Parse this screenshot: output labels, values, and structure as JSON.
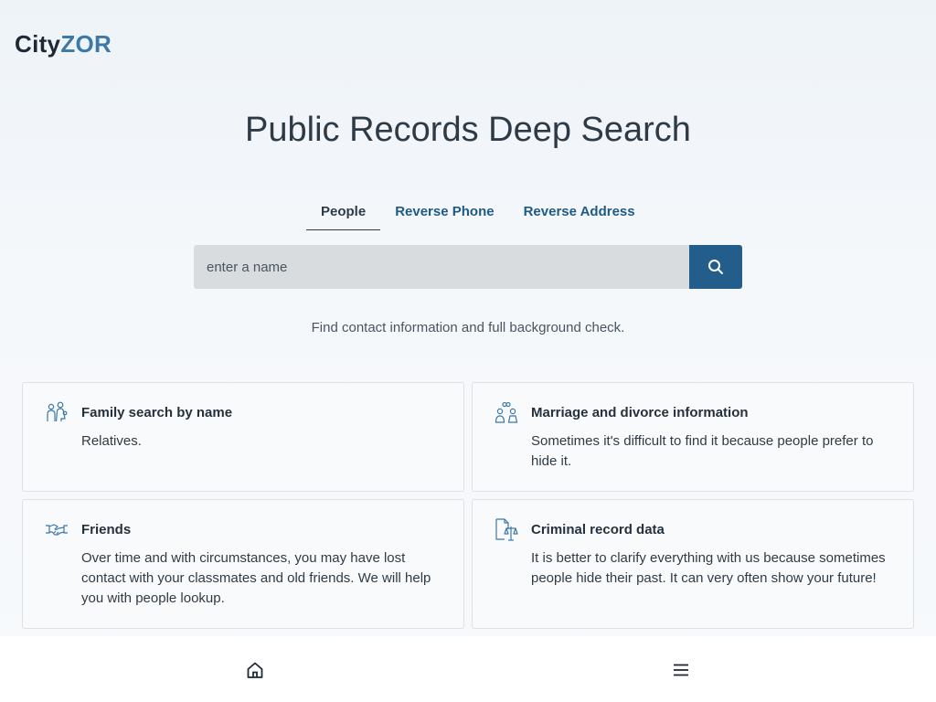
{
  "logo": {
    "part1": "City",
    "part2": "ZOR"
  },
  "hero": {
    "title": "Public Records Deep Search"
  },
  "tabs": [
    {
      "label": "People",
      "active": true
    },
    {
      "label": "Reverse Phone",
      "active": false
    },
    {
      "label": "Reverse Address",
      "active": false
    }
  ],
  "search": {
    "placeholder": "enter a name",
    "value": "",
    "button_icon": "search-icon"
  },
  "subtitle": "Find contact information and full background check.",
  "features": [
    {
      "icon": "family-icon",
      "title": "Family search by name",
      "description": "Relatives."
    },
    {
      "icon": "marriage-icon",
      "title": "Marriage and divorce information",
      "description": "Sometimes it's difficult to find it because people prefer to hide it."
    },
    {
      "icon": "handshake-icon",
      "title": "Friends",
      "description": "Over time and with circumstances, you may have lost contact with your classmates and old friends. We will help you with people lookup."
    },
    {
      "icon": "scales-icon",
      "title": "Criminal record data",
      "description": "It is better to clarify everything with us because sometimes people hide their past. It can very often show your future!"
    }
  ],
  "bottom_nav": {
    "home_icon": "home-icon",
    "menu_icon": "menu-icon"
  },
  "colors": {
    "brand_dark": "#1d2a36",
    "brand_accent": "#3c78a8",
    "button": "#235d8c",
    "tab_link": "#1f5a85"
  }
}
